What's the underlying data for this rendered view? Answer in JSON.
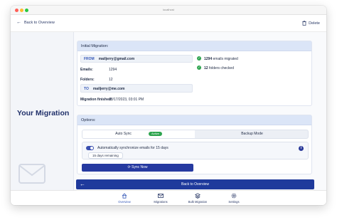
{
  "window": {
    "title": "localhost"
  },
  "toolbar": {
    "back_label": "Back to Overview",
    "delete_label": "Delete"
  },
  "left": {
    "title": "Your Migration"
  },
  "initial": {
    "header": "Initial Migration:",
    "from_tag": "FROM",
    "from_email": "mailjerry@gmail.com",
    "emails_label": "Emails:",
    "emails_value": "1294",
    "folders_label": "Folders:",
    "folders_value": "12",
    "to_tag": "TO",
    "to_email": "mailjerry@me.com",
    "finished_label": "Migration finished:",
    "finished_value": "10/17/2023, 03:01 PM",
    "stat1_num": "1294",
    "stat1_text": "emails migrated",
    "stat2_num": "12",
    "stat2_text": "folders checked"
  },
  "options": {
    "header": "Options:",
    "tab_auto": "Auto Sync",
    "tab_auto_badge": "Active",
    "tab_backup": "Backup Mode",
    "sync_text": "Automatically synchronize emails for 15 days",
    "days_remaining": "15 days remaining",
    "sync_now": "Sync Now",
    "toggle_on": true
  },
  "footer": {
    "back_button": "Back to Overview"
  },
  "nav": {
    "items": [
      {
        "label": "Overview",
        "icon": "home-icon"
      },
      {
        "label": "Migrations",
        "icon": "mail-icon"
      },
      {
        "label": "Bulk Migration",
        "icon": "layers-icon"
      },
      {
        "label": "Settings",
        "icon": "gear-icon"
      }
    ]
  },
  "colors": {
    "accent": "#1f3a9c",
    "success": "#2ea44f",
    "header_bg": "#dbe5f7"
  }
}
